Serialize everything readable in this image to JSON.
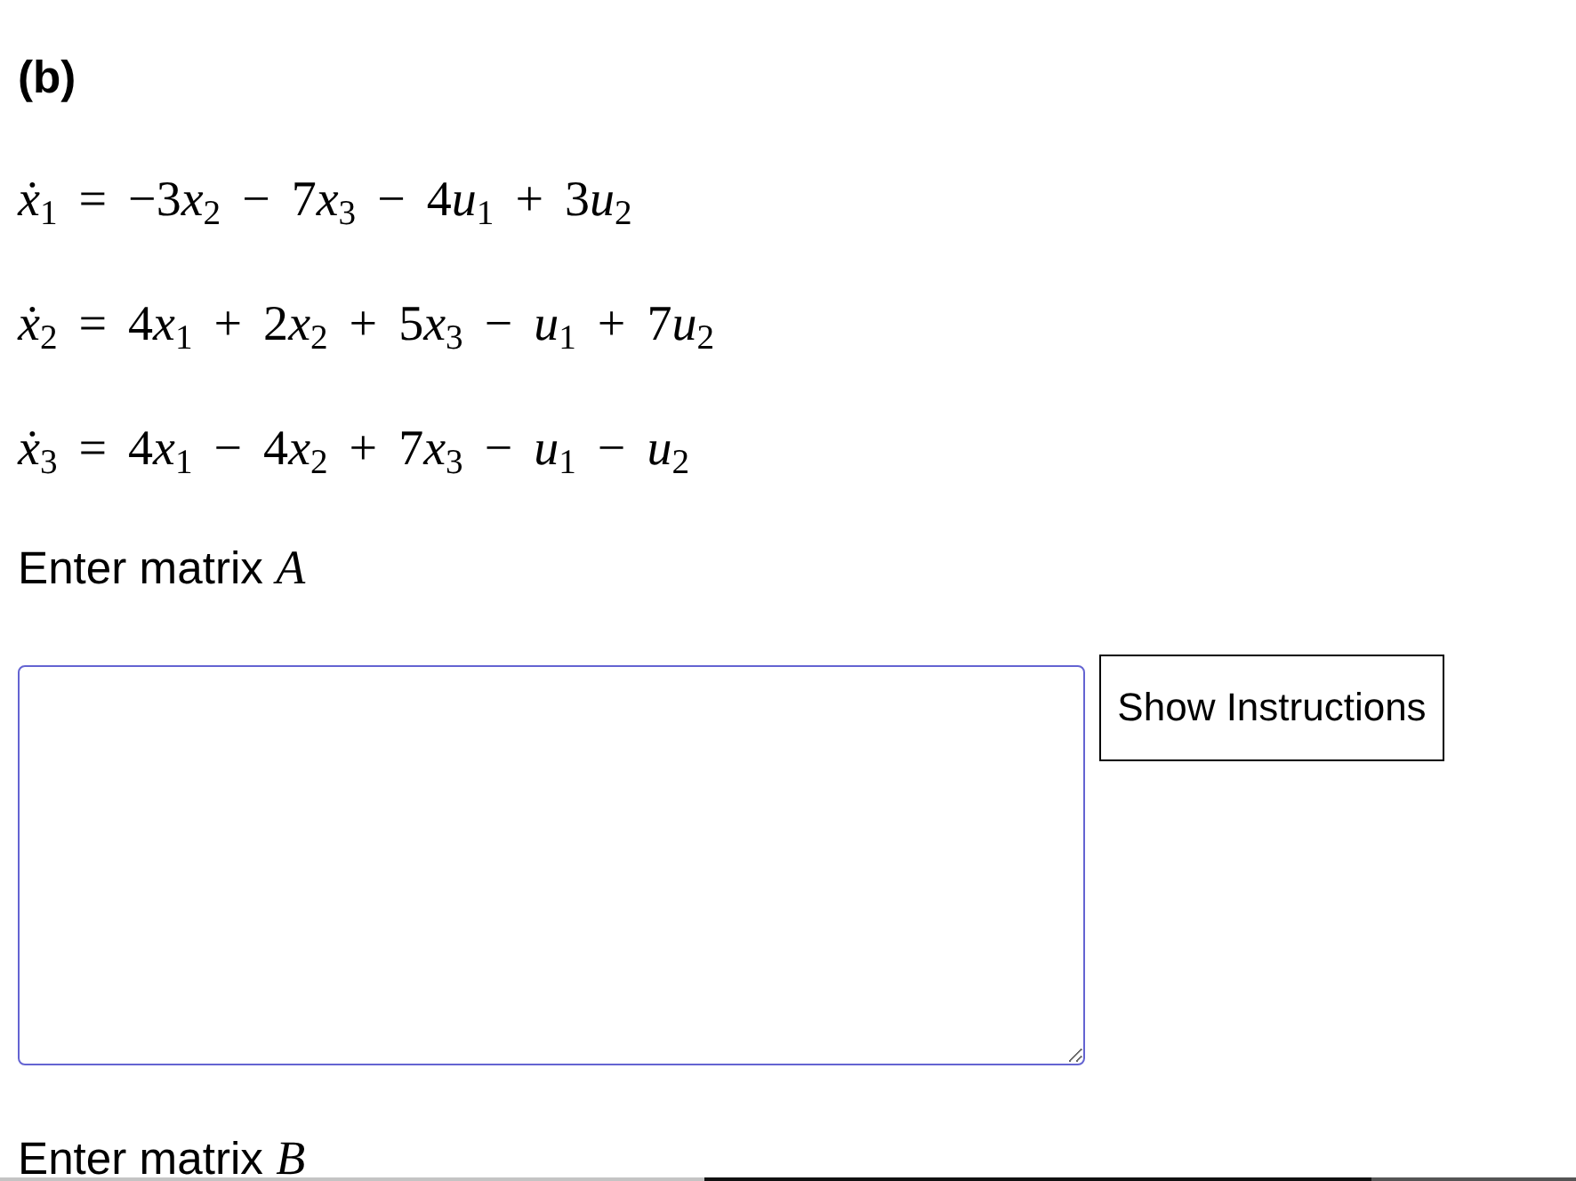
{
  "heading": "(b)",
  "equations": [
    "ẋ$_{1}$ = −3x$_{2}$ − 7x$_{3}$ − 4u$_{1}$ + 3u$_{2}$",
    "ẋ$_{2}$ = 4x$_{1}$ + 2x$_{2}$ + 5x$_{3}$ − u$_{1}$ + 7u$_{2}$",
    "ẋ$_{3}$ = 4x$_{1}$ − 4x$_{2}$ + 7x$_{3}$ − u$_{1}$ − u$_{2}$"
  ],
  "sections": [
    {
      "label": "Enter matrix *A*",
      "button": "Show Instructions"
    },
    {
      "label": "Enter matrix *B*"
    }
  ]
}
